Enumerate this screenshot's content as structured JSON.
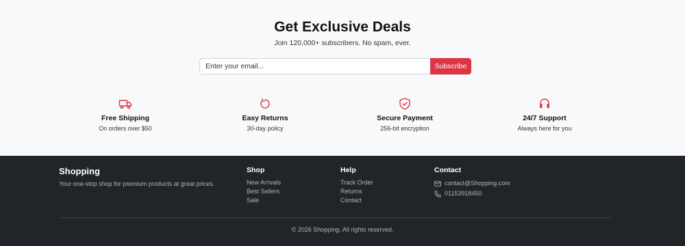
{
  "newsletter": {
    "title": "Get Exclusive Deals",
    "subtitle": "Join 120,000+ subscribers. No spam, ever.",
    "email_placeholder": "Enter your email...",
    "subscribe_label": "Subscribe"
  },
  "features": [
    {
      "icon": "truck-icon",
      "title": "Free Shipping",
      "desc": "On orders over $50"
    },
    {
      "icon": "rotate-icon",
      "title": "Easy Returns",
      "desc": "30-day policy"
    },
    {
      "icon": "shield-check-icon",
      "title": "Secure Payment",
      "desc": "256-bit encryption"
    },
    {
      "icon": "headset-icon",
      "title": "24/7 Support",
      "desc": "Always here for you"
    }
  ],
  "footer": {
    "brand": "Shopping",
    "tagline": "Your one-stop shop for premium products at great prices.",
    "shop": {
      "heading": "Shop",
      "links": [
        "New Arrivals",
        "Best Sellers",
        "Sale"
      ]
    },
    "help": {
      "heading": "Help",
      "links": [
        "Track Order",
        "Returns",
        "Contact"
      ]
    },
    "contact": {
      "heading": "Contact",
      "email": "contact@Shopping.com",
      "phone": "01153918450"
    },
    "copyright": "© 2026 Shopping. All rights reserved."
  },
  "colors": {
    "accent": "#dc3545",
    "footer_bg": "#212529",
    "page_bg": "#f8f9fa"
  }
}
